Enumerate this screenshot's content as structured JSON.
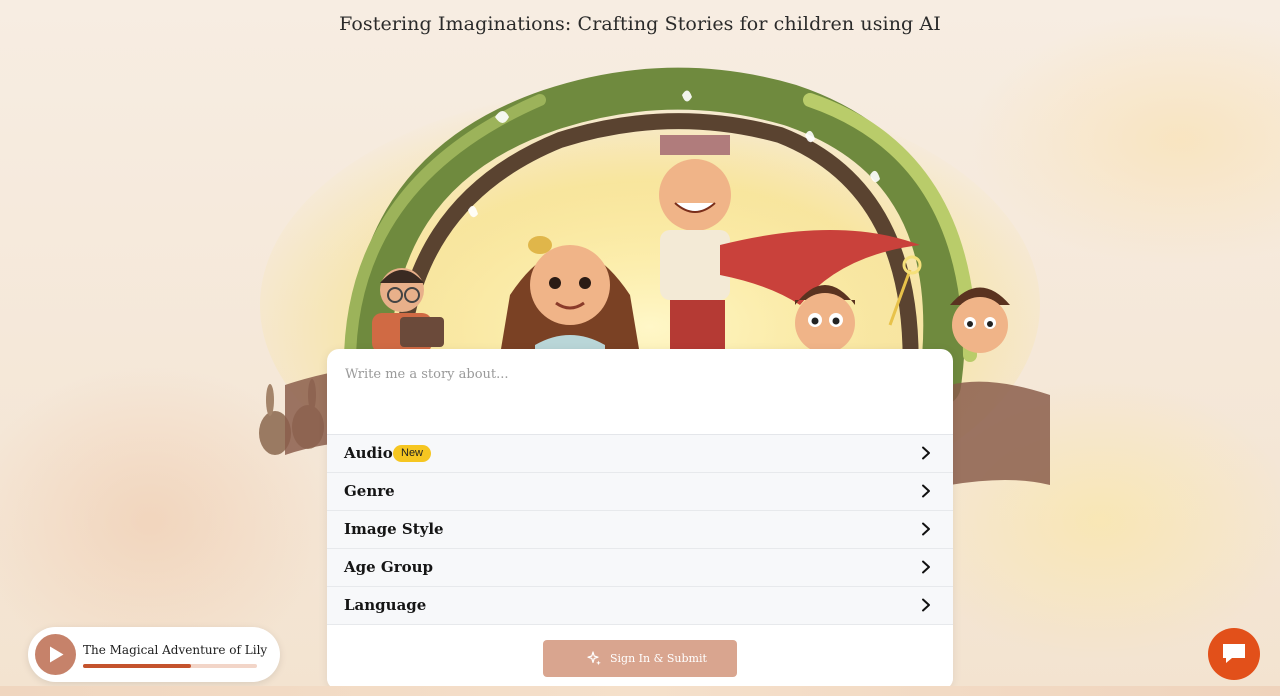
{
  "hero": {
    "subtitle": "Fostering Imaginations: Crafting Stories for children using AI"
  },
  "story_form": {
    "prompt_placeholder": "Write me a story about...",
    "prompt_value": "",
    "options": [
      {
        "label": "Audio",
        "badge": "New",
        "icon": "chevron-right-icon"
      },
      {
        "label": "Genre",
        "icon": "chevron-right-icon"
      },
      {
        "label": "Image Style",
        "icon": "chevron-right-icon"
      },
      {
        "label": "Age Group",
        "icon": "chevron-right-icon"
      },
      {
        "label": "Language",
        "icon": "chevron-right-icon"
      }
    ],
    "submit_label": "Sign In & Submit",
    "submit_icon": "sparkles-icon"
  },
  "audio_player": {
    "title": "The Magical Adventure of Lily",
    "progress": 0.62,
    "play_icon": "play-icon"
  },
  "chat": {
    "icon": "chat-bubble-icon"
  },
  "colors": {
    "accent": "#c4532d",
    "submit_bg": "#d9a58f",
    "badge_bg": "#f6c621",
    "chat_bg": "#e2501a"
  }
}
